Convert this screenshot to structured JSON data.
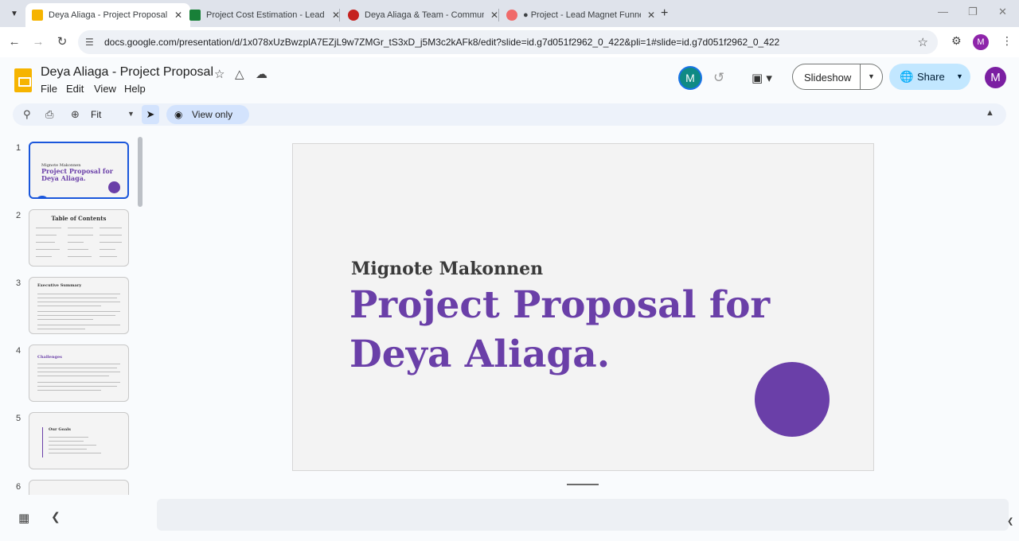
{
  "browser": {
    "tabs": [
      {
        "title": "Deya Aliaga - Project Proposal",
        "color": "#f6b400",
        "active": true
      },
      {
        "title": "Project Cost Estimation - Lead M",
        "color": "#188038",
        "active": false
      },
      {
        "title": "Deya Aliaga & Team - Communi",
        "color": "#c5221f",
        "active": false
      },
      {
        "title": "● Project - Lead Magnet Funnel",
        "color": "#f06a6a",
        "active": false
      }
    ],
    "url": "docs.google.com/presentation/d/1x078xUzBwzplA7EZjL9w7ZMGr_tS3xD_j5M3c2kAFk8/edit?slide=id.g7d051f2962_0_422&pli=1#slide=id.g7d051f2962_0_422",
    "profile_initial": "M"
  },
  "app": {
    "title": "Deya Aliaga - Project Proposal",
    "menu": [
      "File",
      "Edit",
      "View",
      "Help"
    ],
    "collaborator_initial": "M",
    "slideshow_label": "Slideshow",
    "share_label": "Share",
    "account_initial": "M",
    "brand_color": "#f6b400",
    "share_bg": "#c2e7ff"
  },
  "toolbar": {
    "zoom": "Fit",
    "view_mode": "View only"
  },
  "filmstrip": {
    "numbers": [
      "1",
      "2",
      "3",
      "4",
      "5",
      "6"
    ],
    "slide1": {
      "name": "Mignote Makonnen",
      "title": "Project Proposal for Deya Aliaga."
    },
    "slide2": {
      "heading": "Table of Contents"
    },
    "slide3": {
      "heading": "Executive Summary"
    },
    "slide4": {
      "heading": "Challenges"
    },
    "slide5": {
      "heading": "Our Goals"
    }
  },
  "slide": {
    "presenter": "Mignote Makonnen",
    "title_line1": "Project Proposal for",
    "title_line2": "Deya Aliaga.",
    "accent_color": "#6a3fa8"
  }
}
